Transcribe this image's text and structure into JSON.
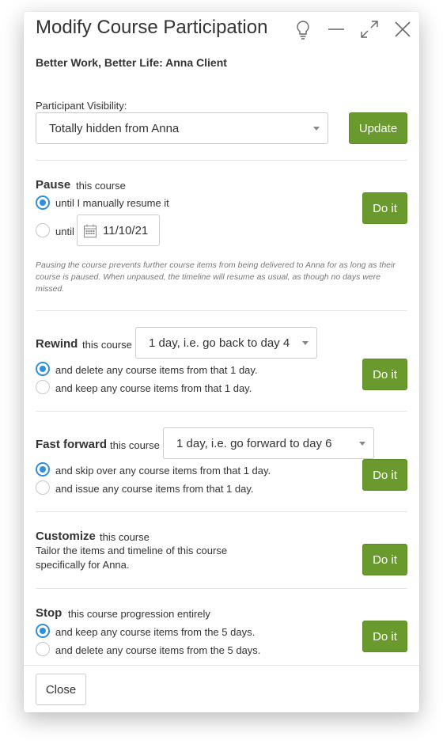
{
  "dialog": {
    "title": "Modify Course Participation",
    "subtitle": "Better Work, Better Life: Anna Client",
    "header_icons": [
      "lightbulb-icon",
      "minimize-icon",
      "expand-icon",
      "close-icon"
    ]
  },
  "visibility": {
    "label": "Participant Visibility:",
    "selected": "Totally hidden from Anna",
    "button": "Update"
  },
  "pause": {
    "title": "Pause",
    "subtitle": "this course",
    "option1": "until I manually resume it",
    "option2": "until",
    "date": "11/10/21",
    "button": "Do it",
    "note": "Pausing the course prevents further course items from being delivered to Anna for as long as their course is paused. When unpaused, the timeline will resume as usual, as though no days were missed."
  },
  "rewind": {
    "title": "Rewind",
    "subtitle": "this course",
    "selected": "1 day, i.e. go back to day 4",
    "option1": "and delete any course items from that 1 day.",
    "option2": "and keep any course items from that 1 day.",
    "button": "Do it"
  },
  "fastforward": {
    "title": "Fast forward",
    "subtitle": "this course",
    "selected": "1 day, i.e. go forward to day 6",
    "option1": "and skip over any course items from that 1 day.",
    "option2": "and issue any course items from that 1 day.",
    "button": "Do it"
  },
  "customize": {
    "title": "Customize",
    "subtitle": "this course",
    "desc_line1": "Tailor the items and timeline of this course",
    "desc_line2": "specifically for Anna.",
    "button": "Do it"
  },
  "stop": {
    "title": "Stop",
    "subtitle": "this course progression entirely",
    "option1": "and keep any course items from the 5 days.",
    "option2": "and delete any course items from the 5 days.",
    "button": "Do it"
  },
  "footer": {
    "close": "Close"
  },
  "colors": {
    "accent_green": "#6a9a2e",
    "radio_blue": "#2f8fd8"
  }
}
